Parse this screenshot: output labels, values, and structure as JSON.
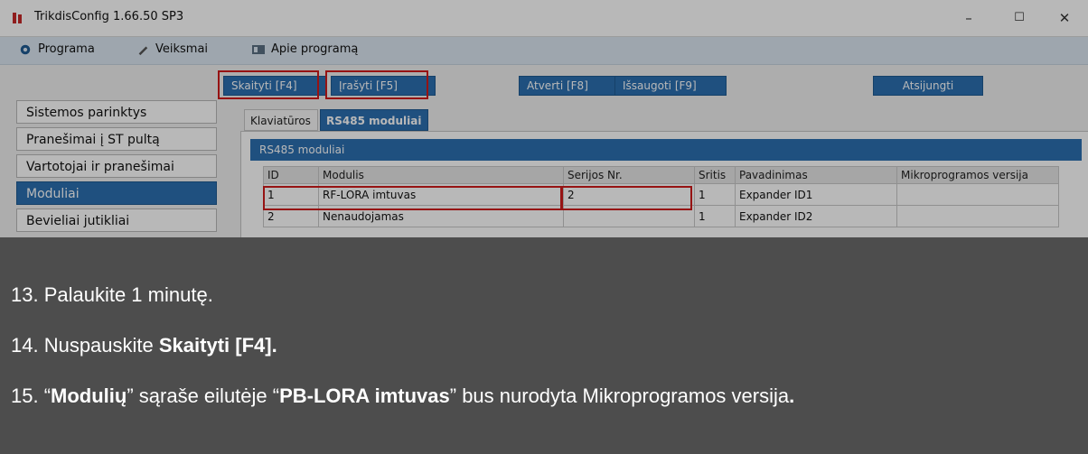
{
  "window": {
    "title": "TrikdisConfig 1.66.50  SP3",
    "minimize": "–",
    "maximize": "☐",
    "close": "✕"
  },
  "menu": {
    "programa": "Programa",
    "veiksmai": "Veiksmai",
    "apie": "Apie programą"
  },
  "toolbar": {
    "read": "Skaityti [F4]",
    "write": "Įrašyti [F5]",
    "open": "Atverti [F8]",
    "save": "Išsaugoti [F9]",
    "disconnect": "Atsijungti"
  },
  "sidebar": {
    "items": [
      {
        "label": "Sistemos parinktys"
      },
      {
        "label": "Pranešimai į ST pultą"
      },
      {
        "label": "Vartotojai ir pranešimai"
      },
      {
        "label": "Moduliai"
      },
      {
        "label": "Bevieliai jutikliai"
      }
    ]
  },
  "tabs": {
    "keyboards": "Klaviatūros",
    "rs485": "RS485 moduliai"
  },
  "panel": {
    "header": "RS485 moduliai",
    "columns": [
      "ID",
      "Modulis",
      "Serijos Nr.",
      "Sritis",
      "Pavadinimas",
      "Mikroprogramos versija"
    ],
    "rows": [
      {
        "id": "1",
        "modulis": "RF-LORA imtuvas",
        "serial": "2",
        "sritis": "1",
        "name": "Expander ID1",
        "fw": ""
      },
      {
        "id": "2",
        "modulis": "Nenaudojamas",
        "serial": "",
        "sritis": "1",
        "name": "Expander ID2",
        "fw": ""
      }
    ]
  },
  "steps": {
    "s13": "13. Palaukite 1 minutę.",
    "s14_prefix": "14. Nuspauskite ",
    "s14_bold": "Skaityti [F4]",
    "s14_suffix": ".",
    "s15_prefix": "15. “",
    "s15_bold1": "Modulių",
    "s15_mid1": "” sąraše eilutėje “",
    "s15_bold2": "PB-LORA imtuvas",
    "s15_mid2": "” bus nurodyta Mikroprogramos versija",
    "s15_bold3": "."
  }
}
